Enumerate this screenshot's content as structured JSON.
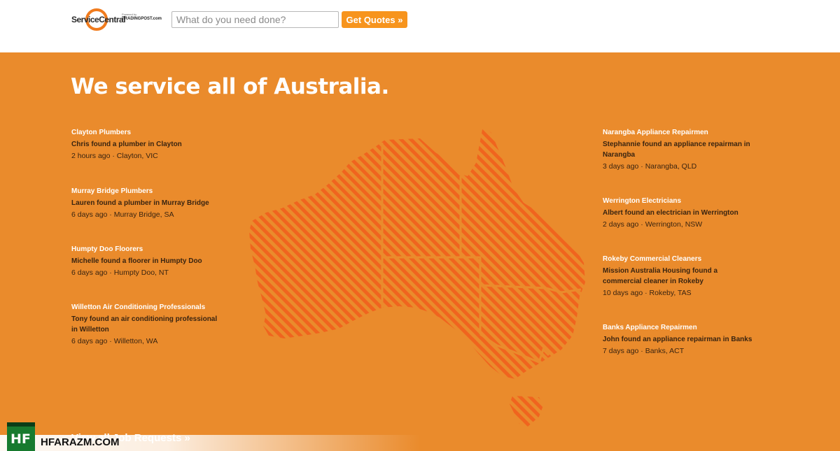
{
  "header": {
    "logo_text": "ServiceCentral",
    "logo_powered": "Powered by",
    "logo_partner": "TRADINGPOST.com",
    "search_placeholder": "What do you need done?",
    "quote_button": "Get Quotes »"
  },
  "main": {
    "heading": "We service all of Australia.",
    "view_all": "View all Job Requests »"
  },
  "jobs_left": [
    {
      "title": "Clayton Plumbers",
      "desc": "Chris found a plumber in Clayton",
      "meta": "2 hours ago · Clayton, VIC"
    },
    {
      "title": "Murray Bridge Plumbers",
      "desc": "Lauren found a plumber in Murray Bridge",
      "meta": "6 days ago · Murray Bridge, SA"
    },
    {
      "title": "Humpty Doo Floorers",
      "desc": "Michelle found a floorer in Humpty Doo",
      "meta": "6 days ago · Humpty Doo, NT"
    },
    {
      "title": "Willetton Air Conditioning Professionals",
      "desc": "Tony found an air conditioning professional in Willetton",
      "meta": "6 days ago · Willetton, WA"
    }
  ],
  "jobs_right": [
    {
      "title": "Narangba Appliance Repairmen",
      "desc": "Stephannie found an appliance repairman in Narangba",
      "meta": "3 days ago · Narangba, QLD"
    },
    {
      "title": "Werrington Electricians",
      "desc": "Albert found an electrician in Werrington",
      "meta": "2 days ago · Werrington, NSW"
    },
    {
      "title": "Rokeby Commercial Cleaners",
      "desc": "Mission Australia Housing found a commercial cleaner in Rokeby",
      "meta": "10 days ago · Rokeby, TAS"
    },
    {
      "title": "Banks Appliance Repairmen",
      "desc": "John found an appliance repairman in Banks",
      "meta": "7 days ago · Banks, ACT"
    }
  ],
  "watermark": {
    "badge": "HF",
    "text": "HFARAZM.COM"
  },
  "colors": {
    "background": "#ea8b2c",
    "accent_button": "#f7941d",
    "map_stripe": "#f0641e"
  },
  "icons": {
    "map": "australia-map-icon",
    "logo": "service-central-logo"
  }
}
